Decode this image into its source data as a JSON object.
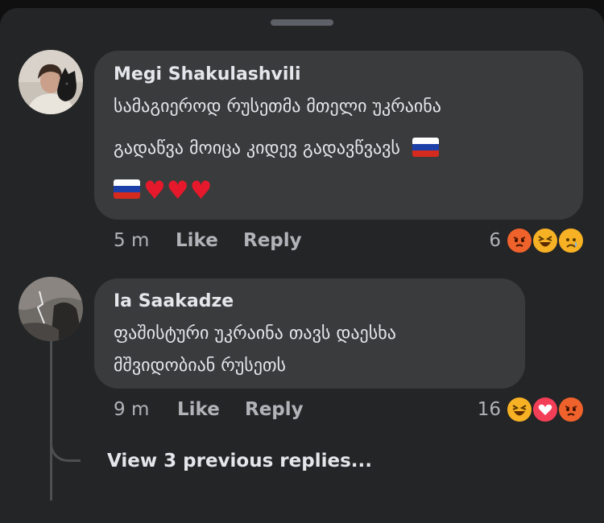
{
  "comments": [
    {
      "author": "Megi Shakulashvili",
      "lines": [
        "სამაგიეროდ რუსეთმა მთელი უკრაინა",
        "გადაწვა მოიცა კიდევ გადავწვავს"
      ],
      "time": "5 m",
      "like": "Like",
      "reply": "Reply",
      "reaction_count": "6",
      "reactions": [
        "angry-icon",
        "laugh-icon",
        "sad-icon"
      ]
    },
    {
      "author": "Ia Saakadze",
      "lines": [
        "ფაშისტური უკრაინა თავს დაესხა",
        "მშვიდობიან რუსეთს"
      ],
      "time": "9 m",
      "like": "Like",
      "reply": "Reply",
      "reaction_count": "16",
      "reactions": [
        "laugh-icon",
        "love-icon",
        "angry-icon"
      ]
    }
  ],
  "view_previous_replies": "View 3 previous replies...",
  "colors": {
    "sheet": "#242526",
    "bubble": "#3a3b3c",
    "text": "#e4e6eb",
    "secondary": "#b0b3b8",
    "angry": "#f0622b",
    "haha": "#f7b125",
    "love": "#f33e58"
  }
}
